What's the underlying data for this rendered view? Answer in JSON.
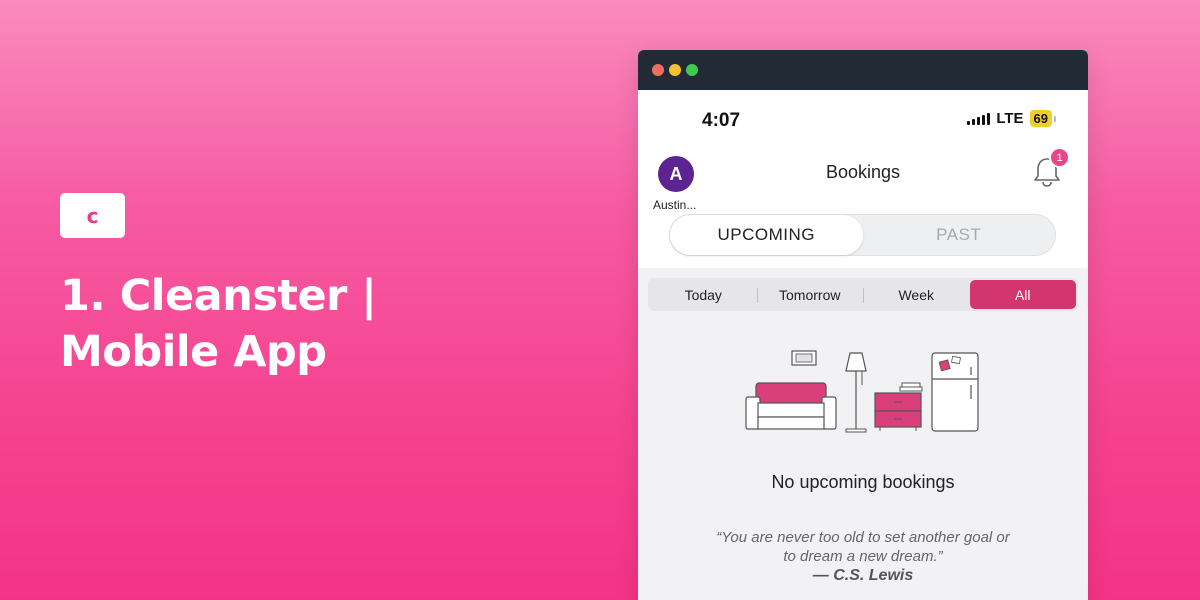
{
  "hero": {
    "logo_letter": "c",
    "title_line1": "1. Cleanster |",
    "title_line2": "Mobile App"
  },
  "status_bar": {
    "time": "4:07",
    "network": "LTE",
    "battery": "69"
  },
  "header": {
    "avatar_initial": "A",
    "avatar_name": "Austin...",
    "title": "Bookings",
    "notification_count": "1"
  },
  "tabs": [
    {
      "label": "UPCOMING",
      "active": true
    },
    {
      "label": "PAST",
      "active": false
    }
  ],
  "filters": [
    {
      "label": "Today",
      "active": false
    },
    {
      "label": "Tomorrow",
      "active": false
    },
    {
      "label": "Week",
      "active": false
    },
    {
      "label": "All",
      "active": true
    }
  ],
  "empty_state": {
    "message": "No upcoming bookings",
    "quote_line1": "“You are never too old to set another goal or",
    "quote_line2": "to dream a new dream.”",
    "author": "— C.S. Lewis"
  },
  "colors": {
    "accent": "#d3356f",
    "avatar": "#5c2391",
    "badge": "#e8468c"
  }
}
